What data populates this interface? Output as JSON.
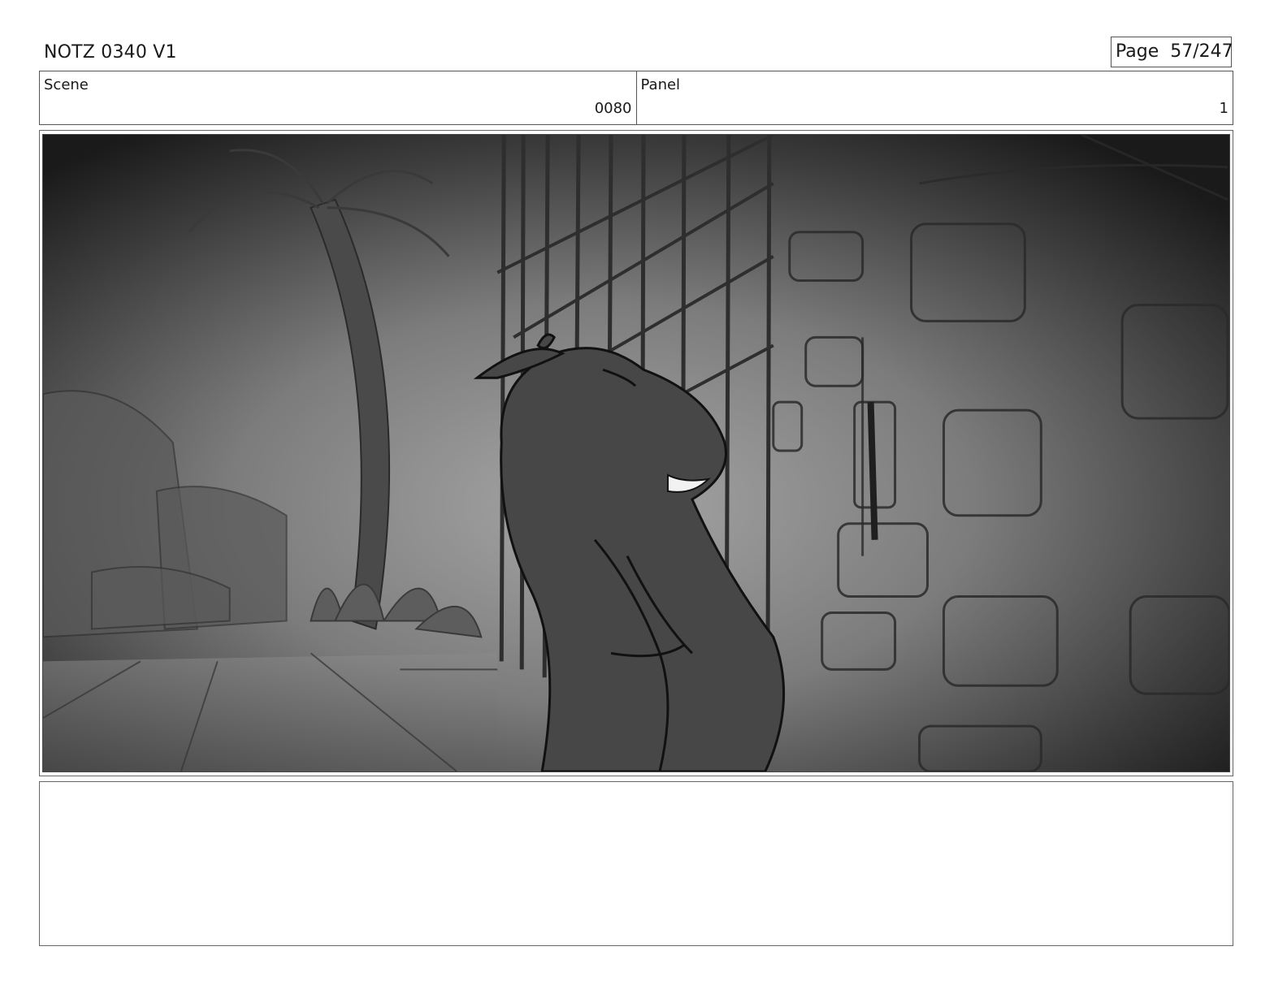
{
  "header": {
    "title": "NOTZ 0340 V1",
    "page_label": "Page",
    "page_value": "57/247"
  },
  "scene": {
    "label": "Scene",
    "value": "0080"
  },
  "panel": {
    "label": "Panel",
    "value": "1"
  },
  "notes": {
    "text": ""
  }
}
